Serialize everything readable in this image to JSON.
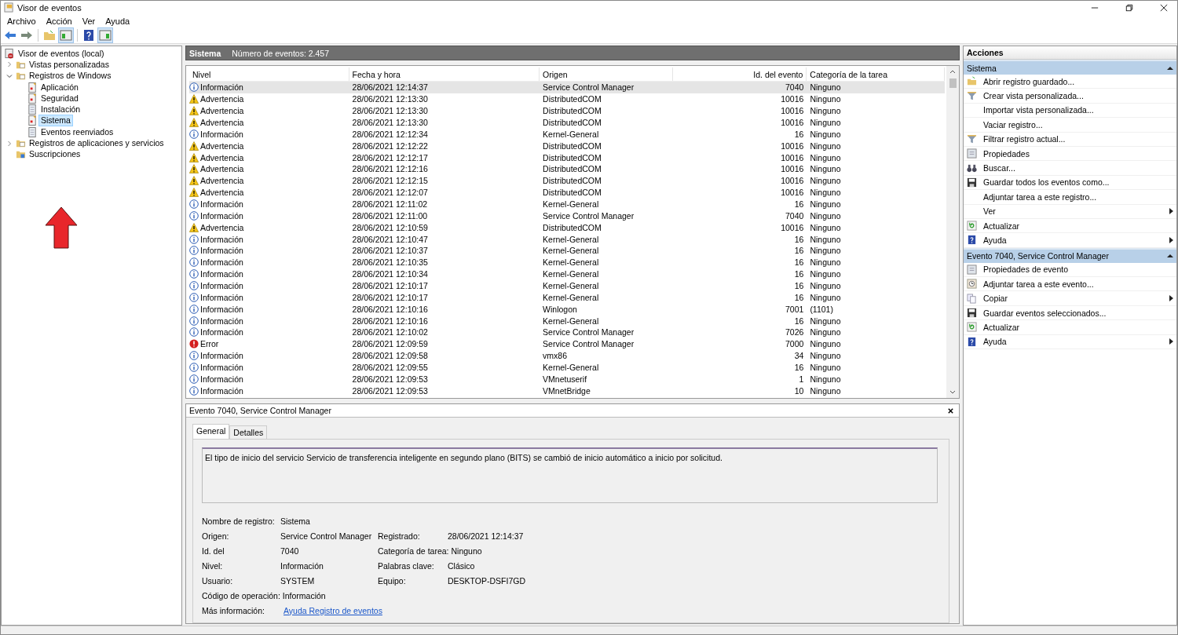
{
  "window": {
    "title": "Visor de eventos"
  },
  "menu": [
    "Archivo",
    "Acción",
    "Ver",
    "Ayuda"
  ],
  "tree": [
    {
      "label": "Visor de eventos (local)",
      "kind": "root",
      "selected": false,
      "children": [
        {
          "label": "Vistas personalizadas",
          "kind": "folder",
          "expanded": false,
          "selected": false
        },
        {
          "label": "Registros de Windows",
          "kind": "folder",
          "expanded": true,
          "selected": false,
          "children": [
            {
              "label": "Aplicación",
              "kind": "log",
              "selected": false
            },
            {
              "label": "Seguridad",
              "kind": "log",
              "selected": false
            },
            {
              "label": "Instalación",
              "kind": "plainlog",
              "selected": false
            },
            {
              "label": "Sistema",
              "kind": "log",
              "selected": true
            },
            {
              "label": "Eventos reenviados",
              "kind": "plainlog",
              "selected": false
            }
          ]
        },
        {
          "label": "Registros de aplicaciones y servicios",
          "kind": "folder",
          "expanded": false,
          "selected": false
        },
        {
          "label": "Suscripciones",
          "kind": "subs",
          "selected": false
        }
      ]
    }
  ],
  "log_header": {
    "name": "Sistema",
    "count": "Número de eventos: 2.457"
  },
  "table": {
    "columns": [
      "Nivel",
      "Fecha y hora",
      "Origen",
      "Id. del evento",
      "Categoría de la tarea"
    ],
    "rows": [
      {
        "kind": "info",
        "level": "Información",
        "date": "28/06/2021 12:14:37",
        "source": "Service Control Manager",
        "id": "7040",
        "category": "Ninguno",
        "selected": true
      },
      {
        "kind": "warning",
        "level": "Advertencia",
        "date": "28/06/2021 12:13:30",
        "source": "DistributedCOM",
        "id": "10016",
        "category": "Ninguno",
        "selected": false
      },
      {
        "kind": "warning",
        "level": "Advertencia",
        "date": "28/06/2021 12:13:30",
        "source": "DistributedCOM",
        "id": "10016",
        "category": "Ninguno",
        "selected": false
      },
      {
        "kind": "warning",
        "level": "Advertencia",
        "date": "28/06/2021 12:13:30",
        "source": "DistributedCOM",
        "id": "10016",
        "category": "Ninguno",
        "selected": false
      },
      {
        "kind": "info",
        "level": "Información",
        "date": "28/06/2021 12:12:34",
        "source": "Kernel-General",
        "id": "16",
        "category": "Ninguno",
        "selected": false
      },
      {
        "kind": "warning",
        "level": "Advertencia",
        "date": "28/06/2021 12:12:22",
        "source": "DistributedCOM",
        "id": "10016",
        "category": "Ninguno",
        "selected": false
      },
      {
        "kind": "warning",
        "level": "Advertencia",
        "date": "28/06/2021 12:12:17",
        "source": "DistributedCOM",
        "id": "10016",
        "category": "Ninguno",
        "selected": false
      },
      {
        "kind": "warning",
        "level": "Advertencia",
        "date": "28/06/2021 12:12:16",
        "source": "DistributedCOM",
        "id": "10016",
        "category": "Ninguno",
        "selected": false
      },
      {
        "kind": "warning",
        "level": "Advertencia",
        "date": "28/06/2021 12:12:15",
        "source": "DistributedCOM",
        "id": "10016",
        "category": "Ninguno",
        "selected": false
      },
      {
        "kind": "warning",
        "level": "Advertencia",
        "date": "28/06/2021 12:12:07",
        "source": "DistributedCOM",
        "id": "10016",
        "category": "Ninguno",
        "selected": false
      },
      {
        "kind": "info",
        "level": "Información",
        "date": "28/06/2021 12:11:02",
        "source": "Kernel-General",
        "id": "16",
        "category": "Ninguno",
        "selected": false
      },
      {
        "kind": "info",
        "level": "Información",
        "date": "28/06/2021 12:11:00",
        "source": "Service Control Manager",
        "id": "7040",
        "category": "Ninguno",
        "selected": false
      },
      {
        "kind": "warning",
        "level": "Advertencia",
        "date": "28/06/2021 12:10:59",
        "source": "DistributedCOM",
        "id": "10016",
        "category": "Ninguno",
        "selected": false
      },
      {
        "kind": "info",
        "level": "Información",
        "date": "28/06/2021 12:10:47",
        "source": "Kernel-General",
        "id": "16",
        "category": "Ninguno",
        "selected": false
      },
      {
        "kind": "info",
        "level": "Información",
        "date": "28/06/2021 12:10:37",
        "source": "Kernel-General",
        "id": "16",
        "category": "Ninguno",
        "selected": false
      },
      {
        "kind": "info",
        "level": "Información",
        "date": "28/06/2021 12:10:35",
        "source": "Kernel-General",
        "id": "16",
        "category": "Ninguno",
        "selected": false
      },
      {
        "kind": "info",
        "level": "Información",
        "date": "28/06/2021 12:10:34",
        "source": "Kernel-General",
        "id": "16",
        "category": "Ninguno",
        "selected": false
      },
      {
        "kind": "info",
        "level": "Información",
        "date": "28/06/2021 12:10:17",
        "source": "Kernel-General",
        "id": "16",
        "category": "Ninguno",
        "selected": false
      },
      {
        "kind": "info",
        "level": "Información",
        "date": "28/06/2021 12:10:17",
        "source": "Kernel-General",
        "id": "16",
        "category": "Ninguno",
        "selected": false
      },
      {
        "kind": "info",
        "level": "Información",
        "date": "28/06/2021 12:10:16",
        "source": "Winlogon",
        "id": "7001",
        "category": "(1101)",
        "selected": false
      },
      {
        "kind": "info",
        "level": "Información",
        "date": "28/06/2021 12:10:16",
        "source": "Kernel-General",
        "id": "16",
        "category": "Ninguno",
        "selected": false
      },
      {
        "kind": "info",
        "level": "Información",
        "date": "28/06/2021 12:10:02",
        "source": "Service Control Manager",
        "id": "7026",
        "category": "Ninguno",
        "selected": false
      },
      {
        "kind": "error",
        "level": "Error",
        "date": "28/06/2021 12:09:59",
        "source": "Service Control Manager",
        "id": "7000",
        "category": "Ninguno",
        "selected": false
      },
      {
        "kind": "info",
        "level": "Información",
        "date": "28/06/2021 12:09:58",
        "source": "vmx86",
        "id": "34",
        "category": "Ninguno",
        "selected": false
      },
      {
        "kind": "info",
        "level": "Información",
        "date": "28/06/2021 12:09:55",
        "source": "Kernel-General",
        "id": "16",
        "category": "Ninguno",
        "selected": false
      },
      {
        "kind": "info",
        "level": "Información",
        "date": "28/06/2021 12:09:53",
        "source": "VMnetuserif",
        "id": "1",
        "category": "Ninguno",
        "selected": false
      },
      {
        "kind": "info",
        "level": "Información",
        "date": "28/06/2021 12:09:53",
        "source": "VMnetBridge",
        "id": "10",
        "category": "Ninguno",
        "selected": false
      }
    ]
  },
  "detail": {
    "title": "Evento 7040, Service Control Manager",
    "tabs": [
      {
        "label": "General",
        "selected": true
      },
      {
        "label": "Detalles",
        "selected": false
      }
    ],
    "message": "El tipo de inicio del servicio Servicio de transferencia inteligente en segundo plano (BITS) se cambió de inicio automático a inicio por solicitud.",
    "fields": [
      [
        {
          "label": "Nombre de registro:",
          "value": "Sistema"
        }
      ],
      [
        {
          "label": "Origen:",
          "value": "Service Control Manager"
        },
        {
          "label": "Registrado:",
          "value": "28/06/2021 12:14:37"
        }
      ],
      [
        {
          "label": "Id. del",
          "value": "7040"
        },
        {
          "label": "Categoría de tarea:",
          "value": "Ninguno"
        }
      ],
      [
        {
          "label": "Nivel:",
          "value": "Información"
        },
        {
          "label": "Palabras clave:",
          "value": "Clásico"
        }
      ],
      [
        {
          "label": "Usuario:",
          "value": "SYSTEM"
        },
        {
          "label": "Equipo:",
          "value": "DESKTOP-DSFI7GD"
        }
      ],
      [
        {
          "label": "Código de operación:",
          "value": "Información"
        }
      ]
    ],
    "more_info": {
      "label": "Más información:",
      "link": "Ayuda Registro de eventos"
    }
  },
  "actions": {
    "title": "Acciones",
    "sections": [
      {
        "title": "Sistema",
        "items": [
          {
            "label": "Abrir registro guardado...",
            "kind": "open"
          },
          {
            "label": "Crear vista personalizada...",
            "kind": "filter"
          },
          {
            "label": "Importar vista personalizada...",
            "kind": "none"
          },
          {
            "label": "Vaciar registro...",
            "kind": "none"
          },
          {
            "label": "Filtrar registro actual...",
            "kind": "filter"
          },
          {
            "label": "Propiedades",
            "kind": "props"
          },
          {
            "label": "Buscar...",
            "kind": "find"
          },
          {
            "label": "Guardar todos los eventos como...",
            "kind": "save"
          },
          {
            "label": "Adjuntar tarea a este registro...",
            "kind": "none"
          },
          {
            "label": "Ver",
            "kind": "submenu"
          },
          {
            "label": "Actualizar",
            "kind": "refresh"
          },
          {
            "label": "Ayuda",
            "kind": "helpsub"
          }
        ]
      },
      {
        "title": "Evento 7040, Service Control Manager",
        "items": [
          {
            "label": "Propiedades de evento",
            "kind": "props"
          },
          {
            "label": "Adjuntar tarea a este evento...",
            "kind": "task"
          },
          {
            "label": "Copiar",
            "kind": "copysub"
          },
          {
            "label": "Guardar eventos seleccionados...",
            "kind": "save"
          },
          {
            "label": "Actualizar",
            "kind": "refresh"
          },
          {
            "label": "Ayuda",
            "kind": "helpsub"
          }
        ]
      }
    ]
  }
}
